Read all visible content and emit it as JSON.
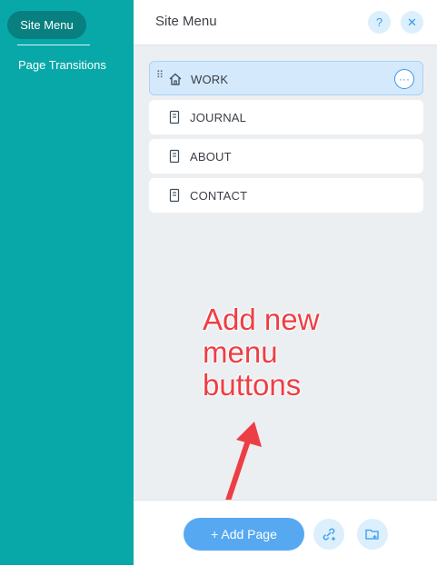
{
  "sidebar": {
    "items": [
      {
        "label": "Site Menu"
      },
      {
        "label": "Page Transitions"
      }
    ]
  },
  "panel": {
    "title": "Site Menu",
    "help_symbol": "?",
    "close_symbol": "✕"
  },
  "pages": [
    {
      "label": "WORK",
      "icon": "home-icon",
      "selected": true
    },
    {
      "label": "JOURNAL",
      "icon": "page-icon"
    },
    {
      "label": "ABOUT",
      "icon": "page-icon"
    },
    {
      "label": "CONTACT",
      "icon": "page-icon"
    }
  ],
  "annotation": {
    "lines": [
      "Add new",
      "menu",
      "buttons"
    ],
    "color": "#ec3f45"
  },
  "footer": {
    "add_page_label": "+ Add Page",
    "link_icon": "add-link-icon",
    "folder_icon": "add-folder-icon"
  },
  "colors": {
    "sidebar": "#09a8a8",
    "accent": "#3899ec",
    "add_button": "#56a9f1"
  }
}
